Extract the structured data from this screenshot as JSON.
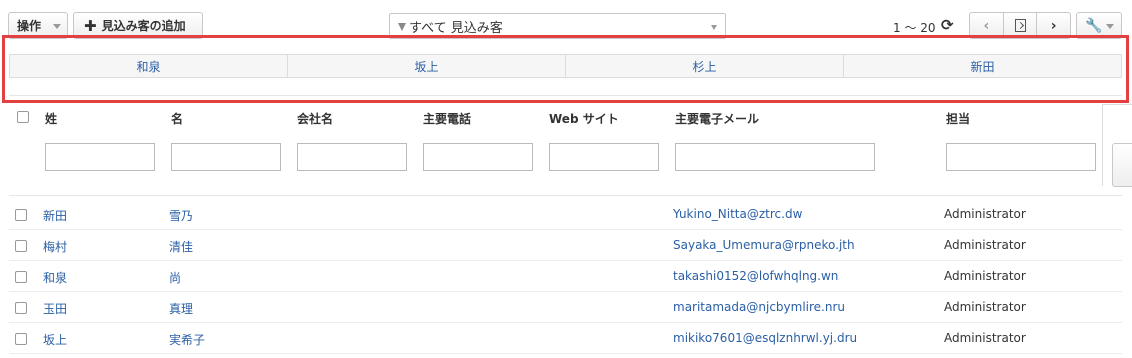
{
  "toolbar": {
    "actions_label": "操作",
    "add_label": "見込み客の追加",
    "filter_value": "すべて 見込み客",
    "pager_text": "1 〜 20"
  },
  "quick_filters": [
    "和泉",
    "坂上",
    "杉上",
    "新田"
  ],
  "columns": {
    "last_name": "姓",
    "first_name": "名",
    "company": "会社名",
    "phone": "主要電話",
    "website": "Web サイト",
    "email": "主要電子メール",
    "owner": "担当"
  },
  "rows": [
    {
      "last_name": "新田",
      "first_name": "雪乃",
      "email": "Yukino_Nitta@ztrc.dw",
      "owner": "Administrator"
    },
    {
      "last_name": "梅村",
      "first_name": "清佳",
      "email": "Sayaka_Umemura@rpneko.jth",
      "owner": "Administrator"
    },
    {
      "last_name": "和泉",
      "first_name": "尚",
      "email": "takashi0152@lofwhqlng.wn",
      "owner": "Administrator"
    },
    {
      "last_name": "玉田",
      "first_name": "真理",
      "email": "maritamada@njcbymlire.nru",
      "owner": "Administrator"
    },
    {
      "last_name": "坂上",
      "first_name": "実希子",
      "email": "mikiko7601@esqlznhrwl.yj.dru",
      "owner": "Administrator"
    }
  ],
  "colors": {
    "link": "#2a5fa5",
    "highlight": "#e34141"
  }
}
